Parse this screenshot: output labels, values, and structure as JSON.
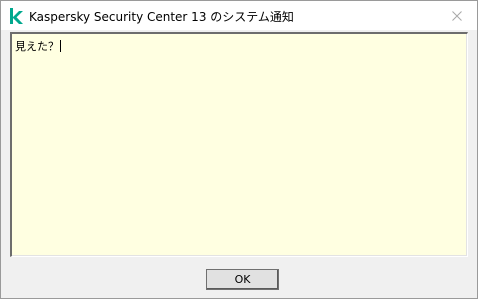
{
  "window": {
    "title": "Kaspersky Security Center 13 のシステム通知",
    "icon": "kaspersky-logo",
    "close_icon": "close-icon"
  },
  "message": {
    "text": "見えた？"
  },
  "buttons": {
    "ok_label": "OK"
  },
  "colors": {
    "brand": "#00a88e",
    "message_background": "#ffffe1",
    "window_background": "#f0f0f0"
  }
}
